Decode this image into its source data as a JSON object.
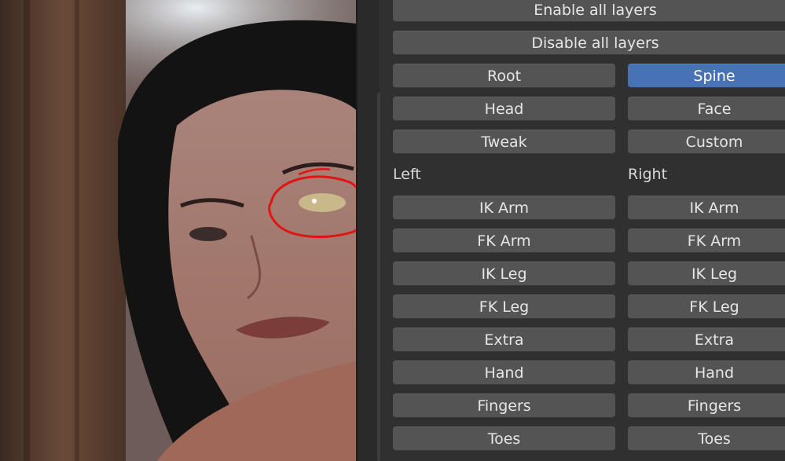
{
  "viewport": {
    "annotation_color": "#e01414"
  },
  "panel": {
    "enable_all": "Enable all layers",
    "disable_all": "Disable all layers",
    "accent": "#4772b3",
    "top_layers": [
      {
        "left": "Root",
        "right": "Spine",
        "right_active": true
      },
      {
        "left": "Head",
        "right": "Face",
        "right_active": false
      },
      {
        "left": "Tweak",
        "right": "Custom",
        "right_active": false
      }
    ],
    "left_header": "Left",
    "right_header": "Right",
    "limb_layers": {
      "left": [
        "IK Arm",
        "FK Arm",
        "IK Leg",
        "FK Leg",
        "Extra",
        "Hand",
        "Fingers",
        "Toes"
      ],
      "right": [
        "IK Arm",
        "FK Arm",
        "IK Leg",
        "FK Leg",
        "Extra",
        "Hand",
        "Fingers",
        "Toes"
      ]
    }
  }
}
